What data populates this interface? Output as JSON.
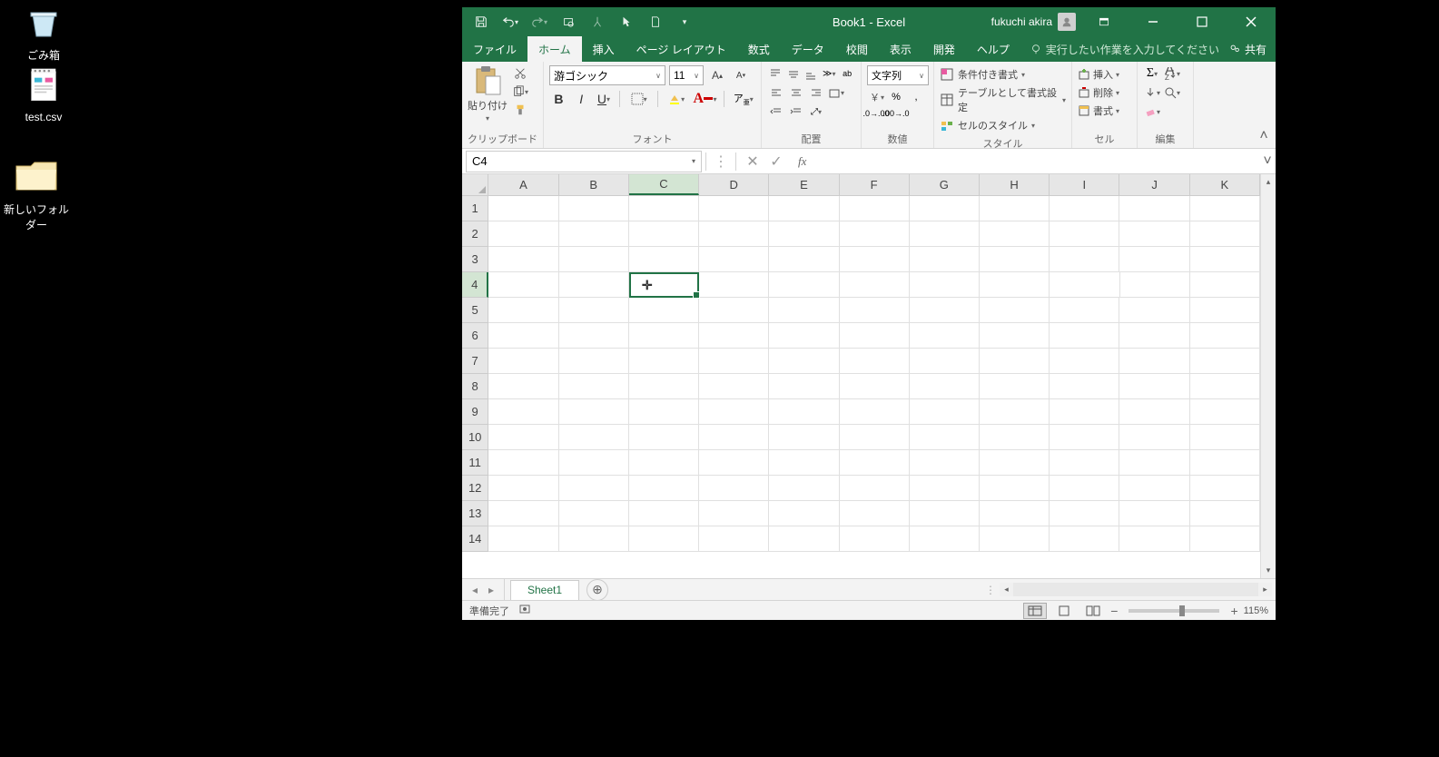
{
  "desktop": {
    "recycle_bin": "ごみ箱",
    "test_csv": "test.csv",
    "new_folder": "新しいフォルダー"
  },
  "titlebar": {
    "title": "Book1  -  Excel",
    "user": "fukuchi akira"
  },
  "ribbon_tabs": {
    "file": "ファイル",
    "home": "ホーム",
    "insert": "挿入",
    "page_layout": "ページ レイアウト",
    "formulas": "数式",
    "data": "データ",
    "review": "校閲",
    "view": "表示",
    "developer": "開発",
    "help": "ヘルプ",
    "tell_me": "実行したい作業を入力してください",
    "share": "共有"
  },
  "ribbon": {
    "clipboard": {
      "paste": "貼り付け",
      "label": "クリップボード"
    },
    "font": {
      "name": "游ゴシック",
      "size": "11",
      "label": "フォント"
    },
    "alignment": {
      "label": "配置"
    },
    "number": {
      "format": "文字列",
      "label": "数値"
    },
    "styles": {
      "conditional": "条件付き書式",
      "table": "テーブルとして書式設定",
      "cell_styles": "セルのスタイル",
      "label": "スタイル"
    },
    "cells": {
      "insert": "挿入",
      "delete": "削除",
      "format": "書式",
      "label": "セル"
    },
    "editing": {
      "label": "編集"
    }
  },
  "formula_bar": {
    "name_box": "C4",
    "fx": "fx"
  },
  "grid": {
    "columns": [
      "A",
      "B",
      "C",
      "D",
      "E",
      "F",
      "G",
      "H",
      "I",
      "J",
      "K"
    ],
    "rows": [
      "1",
      "2",
      "3",
      "4",
      "5",
      "6",
      "7",
      "8",
      "9",
      "10",
      "11",
      "12",
      "13",
      "14"
    ],
    "selected_col_index": 2,
    "selected_row_index": 3
  },
  "sheets": {
    "sheet1": "Sheet1"
  },
  "status": {
    "ready": "準備完了",
    "zoom": "115%"
  }
}
